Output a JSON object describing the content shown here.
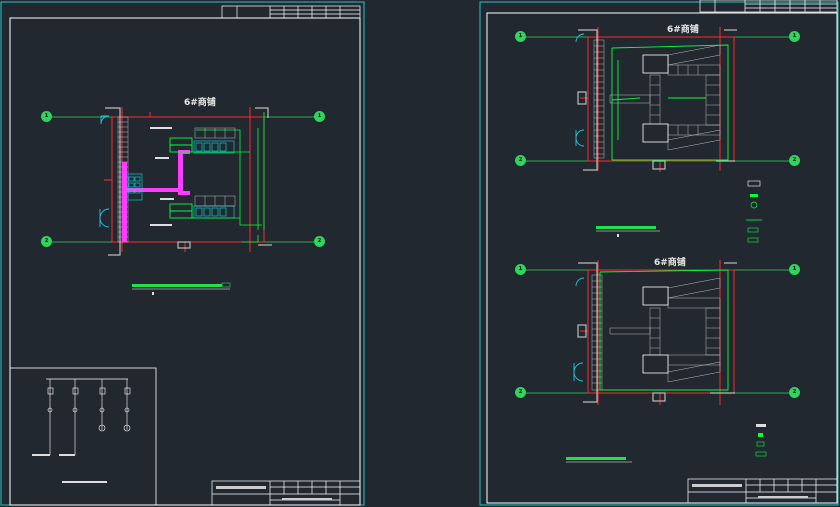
{
  "sheets": [
    {
      "id": "left",
      "plan_title": "6#商铺",
      "axis_left": [
        "1",
        "2"
      ],
      "axis_right": [
        "1",
        "2"
      ]
    },
    {
      "id": "right-top",
      "plan_title": "6#商铺",
      "axis_left": [
        "1",
        "2"
      ],
      "axis_right": [
        "1",
        "2"
      ]
    },
    {
      "id": "right-bottom",
      "plan_title": "6#商铺",
      "axis_left": [
        "1",
        "2"
      ],
      "axis_right": [
        "1",
        "2"
      ]
    }
  ],
  "colors": {
    "background": "#212830",
    "frame": "#ffffff",
    "axis_line": "#2fd45a",
    "wall": "#ff2a2a",
    "pipe": "#00ff3c",
    "duct": "#ff3cff",
    "equipment": "#00e6e6",
    "door": "#1ec8dc",
    "sheet_border": "#1ec8c8"
  }
}
